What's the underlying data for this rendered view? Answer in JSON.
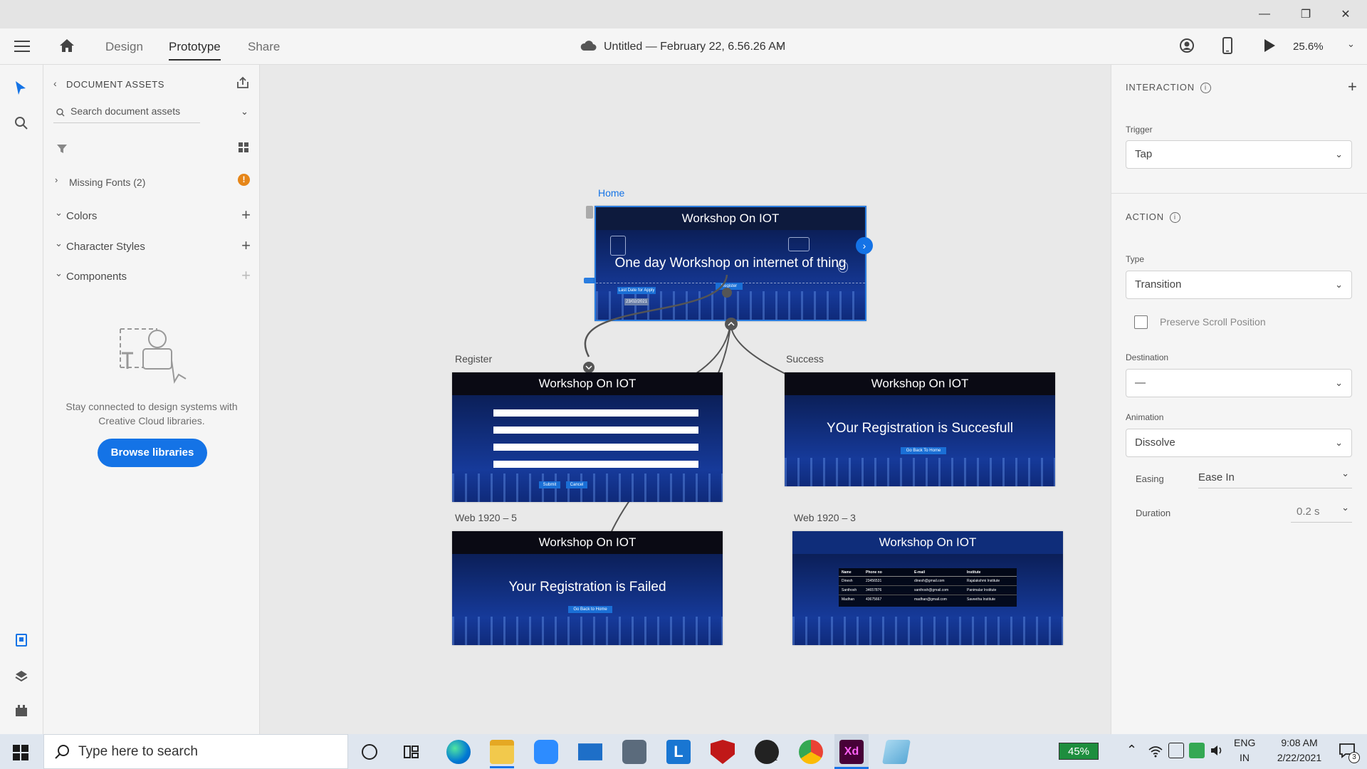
{
  "window": {
    "minimize": "—",
    "restore": "❐",
    "close": "✕"
  },
  "menubar": {
    "tabs": [
      {
        "label": "Design"
      },
      {
        "label": "Prototype"
      },
      {
        "label": "Share"
      }
    ],
    "document_title": "Untitled — February 22, 6.56.26 AM",
    "zoom": "25.6%"
  },
  "assets": {
    "header": "DOCUMENT ASSETS",
    "search_placeholder": "Search document assets",
    "missing_fonts": "Missing Fonts (2)",
    "sections": [
      {
        "label": "Colors"
      },
      {
        "label": "Character Styles"
      },
      {
        "label": "Components"
      }
    ],
    "libraries_message": "Stay connected to design systems with Creative Cloud libraries.",
    "browse_button": "Browse libraries"
  },
  "canvas": {
    "artboards": [
      {
        "label": "Home",
        "header": "Workshop On IOT",
        "body": "One day Workshop on internet of thing",
        "buttons": [
          "Last Date for Apply",
          "Register",
          "23/02/2021"
        ]
      },
      {
        "label": "Register",
        "header": "Workshop On IOT",
        "buttons": [
          "Submit",
          "Cancel"
        ]
      },
      {
        "label": "Success",
        "header": "Workshop On IOT",
        "body": "YOur Registration is Succesfull",
        "buttons": [
          "Go Back To Home"
        ]
      },
      {
        "label": "Web 1920 – 5",
        "header": "Workshop On IOT",
        "body": "Your Registration is Failed",
        "buttons": [
          "Go Back to Home"
        ]
      },
      {
        "label": "Web 1920 – 3",
        "header": "Workshop On IOT",
        "table": {
          "columns": [
            "Name",
            "Phone no",
            "E-mail",
            "Institute"
          ],
          "rows": [
            [
              "Dinesh",
              "23456531",
              "dinesh@gmail.com",
              "Rajalakshmi Institute"
            ],
            [
              "Santhosh",
              "34657876",
              "santhosh@gmail.com",
              "Panimalar Institute"
            ],
            [
              "Madhan",
              "43675667",
              "madhan@gmail.com",
              "Saveetha Institute"
            ]
          ]
        }
      }
    ]
  },
  "properties": {
    "interaction_header": "INTERACTION",
    "trigger_label": "Trigger",
    "trigger_value": "Tap",
    "action_header": "ACTION",
    "type_label": "Type",
    "type_value": "Transition",
    "preserve_scroll": "Preserve Scroll Position",
    "destination_label": "Destination",
    "destination_value": "—",
    "animation_label": "Animation",
    "animation_value": "Dissolve",
    "easing_label": "Easing",
    "easing_value": "Ease In",
    "duration_label": "Duration",
    "duration_value": "0.2 s"
  },
  "taskbar": {
    "search_placeholder": "Type here to search",
    "battery": "45%",
    "language_line1": "ENG",
    "language_line2": "IN",
    "time": "9:08 AM",
    "date": "2/22/2021",
    "xbox_badge": "1",
    "notification_count": "3"
  },
  "colors": {
    "accent": "#1473e6",
    "artboard_blue": "#0a2868",
    "warning": "#e68619",
    "xd_purple": "#470137"
  }
}
